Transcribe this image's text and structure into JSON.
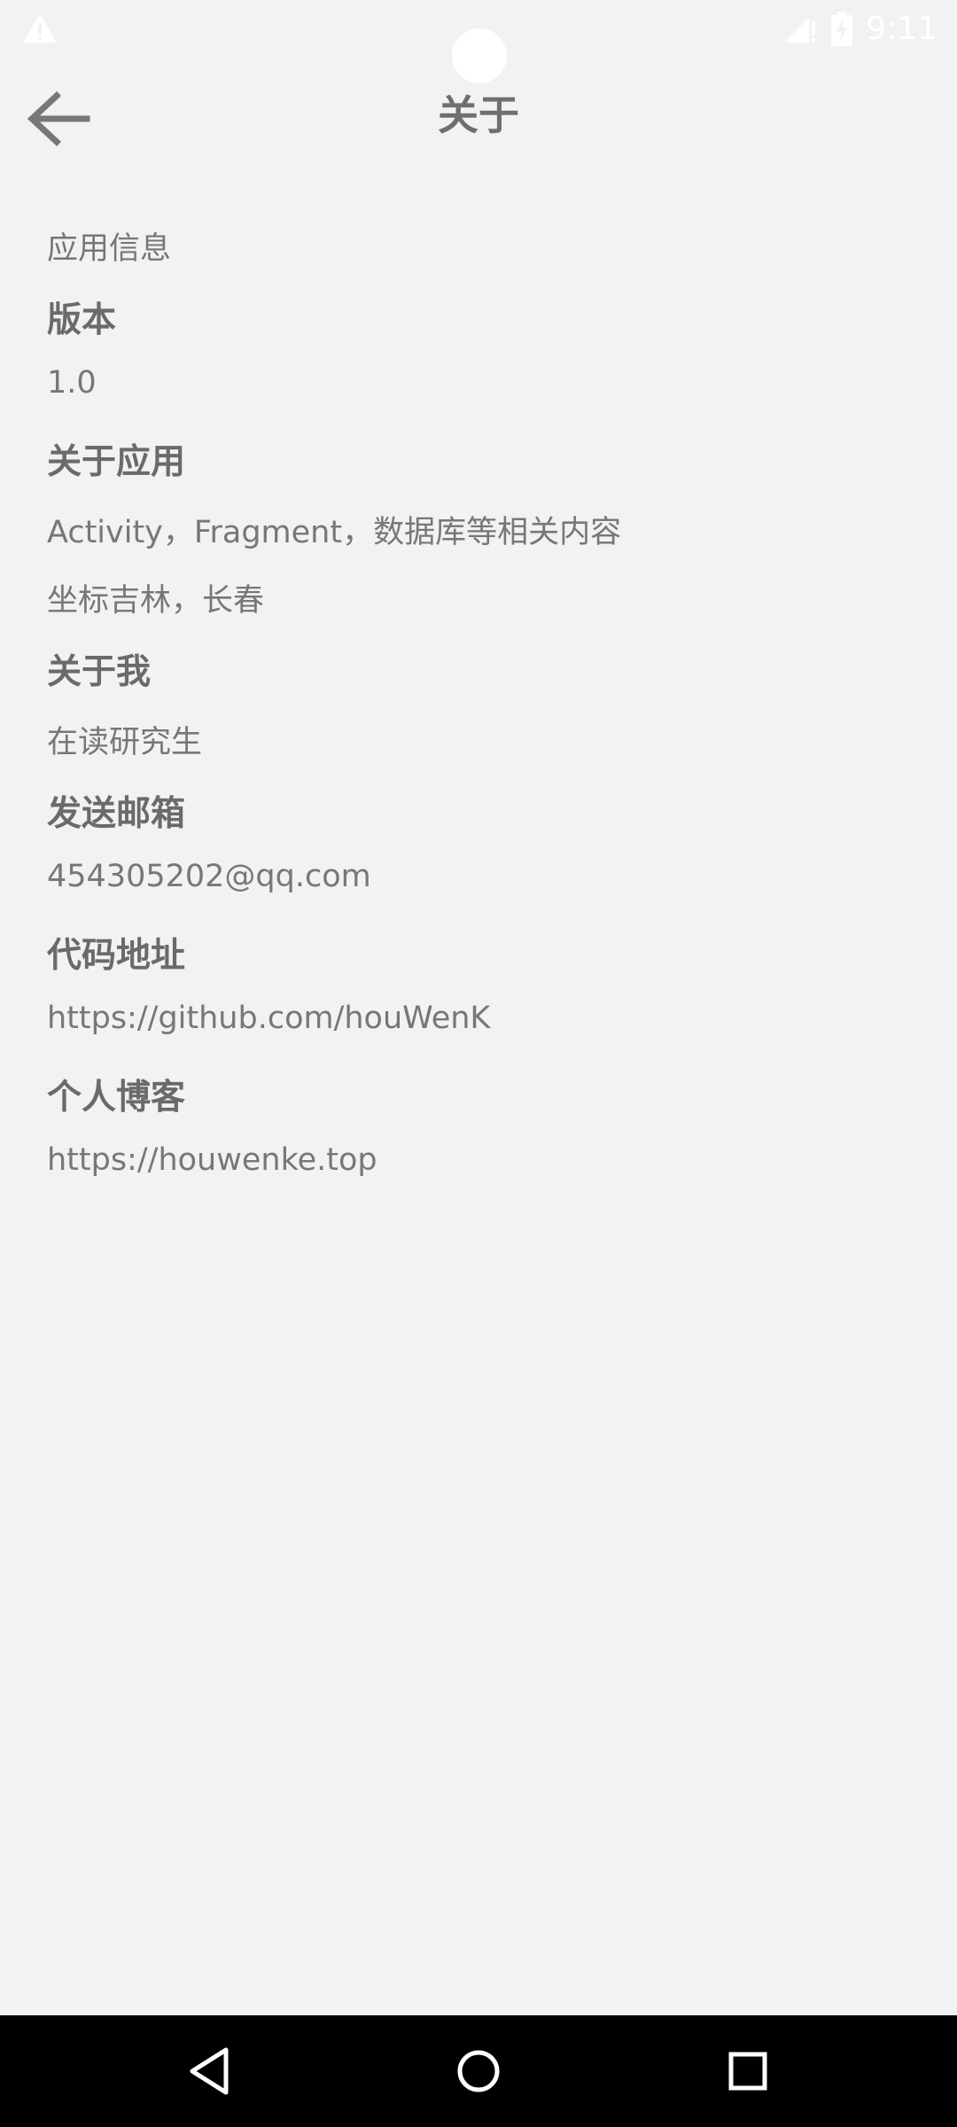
{
  "status_bar": {
    "time": "9:11",
    "icons": [
      "warning-icon",
      "signal-icon",
      "battery-icon"
    ]
  },
  "app_bar": {
    "title": "关于",
    "back_icon": "arrow-back-icon"
  },
  "content": {
    "section_caption": "应用信息",
    "version_heading": "版本",
    "version_value": "1.0",
    "about_app_heading": "关于应用",
    "about_app_line1": "Activity，Fragment，数据库等相关内容",
    "about_app_line2": "坐标吉林，长春",
    "about_me_heading": "关于我",
    "about_me_value": "在读研究生",
    "email_heading": "发送邮箱",
    "email_value": "454305202@qq.com",
    "code_heading": "代码地址",
    "code_value": "https://github.com/houWenK",
    "blog_heading": "个人博客",
    "blog_value": "https://houwenke.top"
  },
  "nav_bar": {
    "icons": [
      "back-triangle-icon",
      "home-circle-icon",
      "recents-square-icon"
    ]
  },
  "colors": {
    "background": "#f2f2f2",
    "text_primary": "#6a6a6a",
    "text_secondary": "#777777",
    "nav_bar": "#000000"
  }
}
